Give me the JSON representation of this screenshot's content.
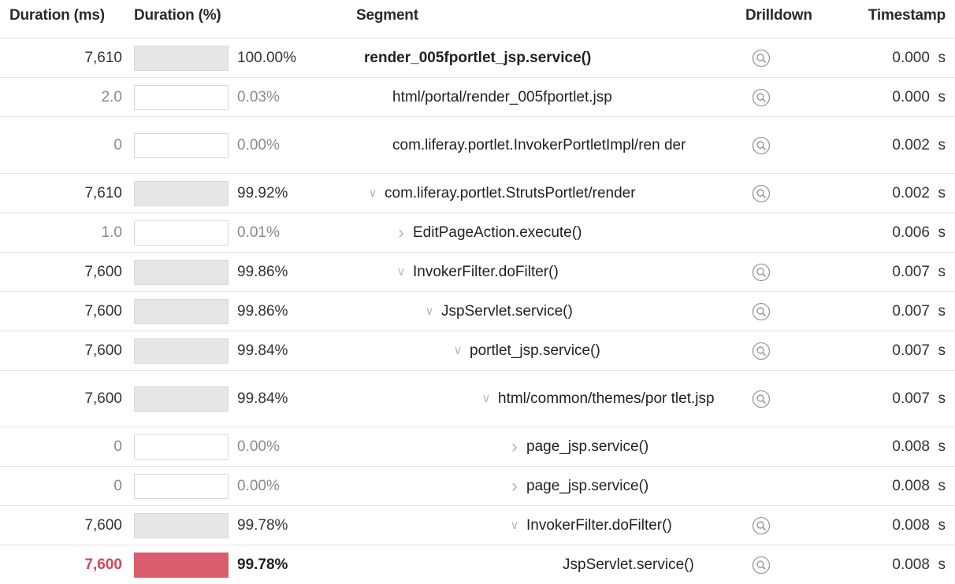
{
  "header": {
    "duration_ms": "Duration (ms)",
    "duration_pct": "Duration (%)",
    "segment": "Segment",
    "drilldown": "Drilldown",
    "timestamp": "Timestamp"
  },
  "colors": {
    "bar_fill": "#e6e6e6",
    "bar_highlight": "#d95d6d",
    "highlight_text": "#d6455a",
    "icon": "#9a9a9a"
  },
  "rows": [
    {
      "ms": "7,610",
      "pct_text": "100.00%",
      "pct": 100.0,
      "segment": "render_005fportlet_jsp.service()",
      "indent": 0,
      "chevron": "none",
      "drilldown": true,
      "timestamp": "0.000  s",
      "style": "root"
    },
    {
      "ms": "2.0",
      "pct_text": "0.03%",
      "pct": 0.03,
      "segment": "html/portal/render_005fportlet.jsp",
      "indent": 1,
      "chevron": "none",
      "drilldown": true,
      "timestamp": "0.000  s",
      "style": "muted"
    },
    {
      "ms": "0",
      "pct_text": "0.00%",
      "pct": 0.0,
      "segment": "com.liferay.portlet.InvokerPortletImpl/ren der",
      "indent": 1,
      "chevron": "none",
      "drilldown": true,
      "timestamp": "0.002  s",
      "style": "muted"
    },
    {
      "ms": "7,610",
      "pct_text": "99.92%",
      "pct": 99.92,
      "segment": "com.liferay.portlet.StrutsPortlet/render",
      "indent": 0,
      "chevron": "down",
      "drilldown": true,
      "timestamp": "0.002  s",
      "style": "normal"
    },
    {
      "ms": "1.0",
      "pct_text": "0.01%",
      "pct": 0.01,
      "segment": "EditPageAction.execute()",
      "indent": 1,
      "chevron": "right",
      "drilldown": false,
      "timestamp": "0.006  s",
      "style": "muted"
    },
    {
      "ms": "7,600",
      "pct_text": "99.86%",
      "pct": 99.86,
      "segment": "InvokerFilter.doFilter()",
      "indent": 1,
      "chevron": "down",
      "drilldown": true,
      "timestamp": "0.007  s",
      "style": "normal"
    },
    {
      "ms": "7,600",
      "pct_text": "99.86%",
      "pct": 99.86,
      "segment": "JspServlet.service()",
      "indent": 2,
      "chevron": "down",
      "drilldown": true,
      "timestamp": "0.007  s",
      "style": "normal"
    },
    {
      "ms": "7,600",
      "pct_text": "99.84%",
      "pct": 99.84,
      "segment": "portlet_jsp.service()",
      "indent": 3,
      "chevron": "down",
      "drilldown": true,
      "timestamp": "0.007  s",
      "style": "normal"
    },
    {
      "ms": "7,600",
      "pct_text": "99.84%",
      "pct": 99.84,
      "segment": "html/common/themes/por tlet.jsp",
      "indent": 4,
      "chevron": "down",
      "drilldown": true,
      "timestamp": "0.007  s",
      "style": "normal"
    },
    {
      "ms": "0",
      "pct_text": "0.00%",
      "pct": 0.0,
      "segment": "page_jsp.service()",
      "indent": 5,
      "chevron": "right",
      "drilldown": false,
      "timestamp": "0.008  s",
      "style": "muted"
    },
    {
      "ms": "0",
      "pct_text": "0.00%",
      "pct": 0.0,
      "segment": "page_jsp.service()",
      "indent": 5,
      "chevron": "right",
      "drilldown": false,
      "timestamp": "0.008  s",
      "style": "muted"
    },
    {
      "ms": "7,600",
      "pct_text": "99.78%",
      "pct": 99.78,
      "segment": "InvokerFilter.doFilter()",
      "indent": 5,
      "chevron": "down",
      "drilldown": true,
      "timestamp": "0.008  s",
      "style": "normal"
    },
    {
      "ms": "7,600",
      "pct_text": "99.78%",
      "pct": 99.78,
      "segment": "JspServlet.service()",
      "indent": 7,
      "chevron": "none",
      "drilldown": true,
      "timestamp": "0.008  s",
      "style": "highlight"
    }
  ]
}
